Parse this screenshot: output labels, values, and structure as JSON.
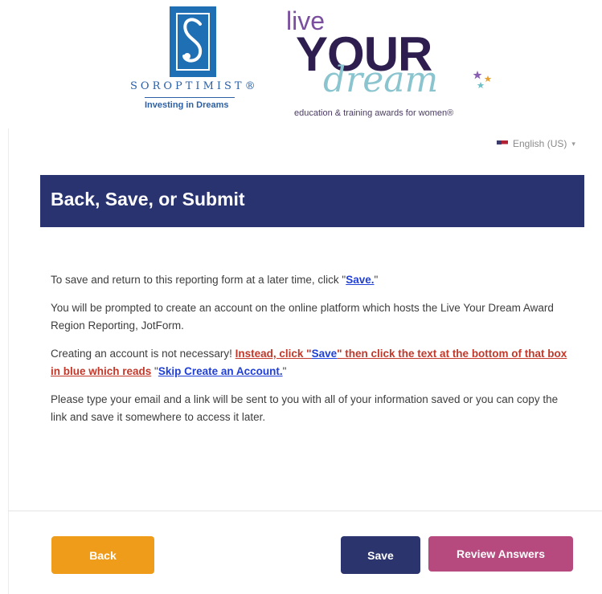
{
  "header": {
    "soroptimist": {
      "name": "SOROPTIMIST®",
      "tagline": "Investing in Dreams"
    },
    "live_your_dream": {
      "live": "live",
      "your": "YOUR",
      "dream": "dream",
      "subtitle": "education & training awards for women®"
    }
  },
  "language": {
    "label": "English (US)",
    "caret": "▾"
  },
  "banner": {
    "title": "Back, Save, or Submit"
  },
  "content": {
    "p1_text": "To save and return to this reporting form at a later time, click \"",
    "p1_link": "Save.",
    "p1_end": "\"",
    "p2": "You will be prompted to create an account on the online platform which hosts the Live Your Dream Award Region Reporting, JotForm.",
    "p3_text": "Creating an account is not necessary! ",
    "p3_red1": "Instead, click \"",
    "p3_link1": "Save",
    "p3_red2": "\" then click the text at the bottom of that box in blue which reads",
    "p3_mid": " \"",
    "p3_link2": "Skip Create an Account.",
    "p3_end": "\"",
    "p4": "Please type your email and a link will be sent to you with all of your information saved or you can copy the link and save it somewhere to access it later."
  },
  "buttons": {
    "back": "Back",
    "save": "Save",
    "review": "Review Answers"
  },
  "colors": {
    "banner": "#293370",
    "back": "#ee9c1a",
    "save": "#2c346e",
    "review": "#b64a7e",
    "link": "#1f3fd6",
    "emphasis": "#c0392b"
  }
}
